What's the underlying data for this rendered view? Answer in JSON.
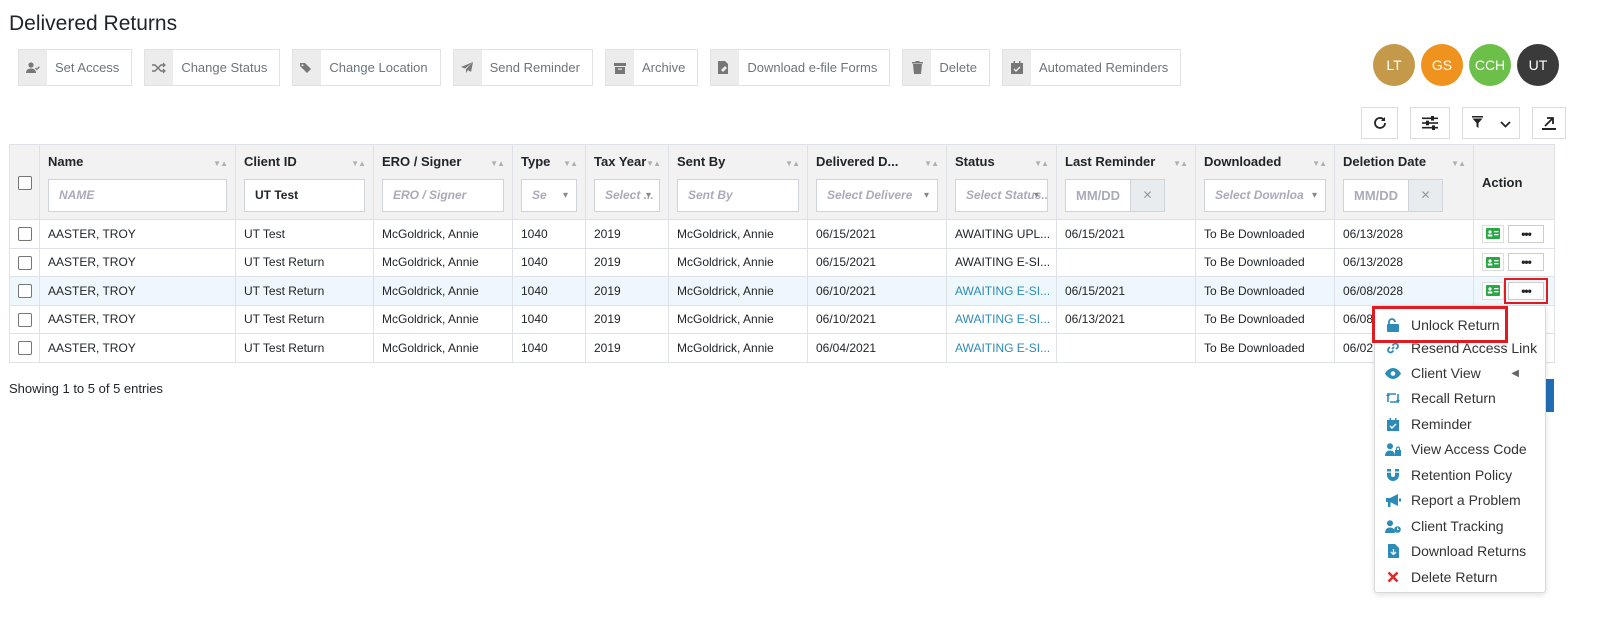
{
  "page": {
    "title": "Delivered Returns"
  },
  "toolbar": [
    {
      "label": "Set Access",
      "icon": "user-check-icon"
    },
    {
      "label": "Change Status",
      "icon": "shuffle-icon"
    },
    {
      "label": "Change Location",
      "icon": "tags-icon"
    },
    {
      "label": "Send Reminder",
      "icon": "paper-plane-icon"
    },
    {
      "label": "Archive",
      "icon": "archive-box-icon"
    },
    {
      "label": "Download e-file Forms",
      "icon": "file-signature-icon"
    },
    {
      "label": "Delete",
      "icon": "trash-icon"
    },
    {
      "label": "Automated Reminders",
      "icon": "calendar-check-icon"
    }
  ],
  "avatars": [
    {
      "initials": "LT",
      "color": "#c49a4a"
    },
    {
      "initials": "GS",
      "color": "#f0921e"
    },
    {
      "initials": "CCH",
      "color": "#6cc04a"
    },
    {
      "initials": "UT",
      "color": "#3a3a3a"
    }
  ],
  "columns": [
    {
      "label": "Name",
      "filter_placeholder": "NAME",
      "filter_type": "text"
    },
    {
      "label": "Client ID",
      "filter_value": "UT Test",
      "filter_type": "text"
    },
    {
      "label": "ERO / Signer",
      "filter_placeholder": "ERO / Signer",
      "filter_type": "text"
    },
    {
      "label": "Type",
      "filter_placeholder": "Se",
      "filter_type": "select"
    },
    {
      "label": "Tax Year",
      "filter_placeholder": "Select ...",
      "filter_type": "select"
    },
    {
      "label": "Sent By",
      "filter_placeholder": "Sent By",
      "filter_type": "text"
    },
    {
      "label": "Delivered D...",
      "filter_placeholder": "Select Delivere",
      "filter_type": "select"
    },
    {
      "label": "Status",
      "filter_placeholder": "Select Status...",
      "filter_type": "select"
    },
    {
      "label": "Last Reminder",
      "filter_placeholder": "MM/DD",
      "filter_type": "date"
    },
    {
      "label": "Downloaded",
      "filter_placeholder": "Select Downloa",
      "filter_type": "select"
    },
    {
      "label": "Deletion Date",
      "filter_placeholder": "MM/DD",
      "filter_type": "date"
    },
    {
      "label": "Action"
    }
  ],
  "rows": [
    {
      "name": "AASTER, TROY",
      "client_id": "UT Test",
      "ero": "McGoldrick, Annie",
      "type": "1040",
      "tax_year": "2019",
      "sent_by": "McGoldrick, Annie",
      "delivered": "06/15/2021",
      "status": "AWAITING UPL...",
      "last_reminder": "06/15/2021",
      "downloaded": "To Be Downloaded",
      "deletion": "06/13/2028"
    },
    {
      "name": "AASTER, TROY",
      "client_id": "UT Test Return",
      "ero": "McGoldrick, Annie",
      "type": "1040",
      "tax_year": "2019",
      "sent_by": "McGoldrick, Annie",
      "delivered": "06/15/2021",
      "status": "AWAITING E-SI...",
      "last_reminder": "",
      "downloaded": "To Be Downloaded",
      "deletion": "06/13/2028"
    },
    {
      "name": "AASTER, TROY",
      "client_id": "UT Test Return",
      "ero": "McGoldrick, Annie",
      "type": "1040",
      "tax_year": "2019",
      "sent_by": "McGoldrick, Annie",
      "delivered": "06/10/2021",
      "status": "AWAITING E-SI...",
      "last_reminder": "06/15/2021",
      "downloaded": "To Be Downloaded",
      "deletion": "06/08/2028"
    },
    {
      "name": "AASTER, TROY",
      "client_id": "UT Test Return",
      "ero": "McGoldrick, Annie",
      "type": "1040",
      "tax_year": "2019",
      "sent_by": "McGoldrick, Annie",
      "delivered": "06/10/2021",
      "status": "AWAITING E-SI...",
      "last_reminder": "06/13/2021",
      "downloaded": "To Be Downloaded",
      "deletion": "06/08"
    },
    {
      "name": "AASTER, TROY",
      "client_id": "UT Test Return",
      "ero": "McGoldrick, Annie",
      "type": "1040",
      "tax_year": "2019",
      "sent_by": "McGoldrick, Annie",
      "delivered": "06/04/2021",
      "status": "AWAITING E-SI...",
      "last_reminder": "",
      "downloaded": "To Be Downloaded",
      "deletion": "06/02"
    }
  ],
  "footer": {
    "showing": "Showing 1 to 5 of 5 entries"
  },
  "context_menu": {
    "items": [
      {
        "label": "Unlock Return",
        "icon": "unlock-icon"
      },
      {
        "label": "Resend Access Link",
        "icon": "link-icon"
      },
      {
        "label": "Client View",
        "icon": "eye-icon"
      },
      {
        "label": "Recall Return",
        "icon": "retweet-icon"
      },
      {
        "label": "Reminder",
        "icon": "calendar-check-icon"
      },
      {
        "label": "View Access Code",
        "icon": "user-lock-icon"
      },
      {
        "label": "Retention Policy",
        "icon": "magnet-icon"
      },
      {
        "label": "Report a Problem",
        "icon": "bullhorn-icon"
      },
      {
        "label": "Client Tracking",
        "icon": "user-clock-icon"
      },
      {
        "label": "Download Returns",
        "icon": "file-download-icon"
      },
      {
        "label": "Delete Return",
        "icon": "times-icon"
      }
    ]
  },
  "colors": {
    "accent": "#2d8bb8",
    "highlight": "#e01b22",
    "row_highlight": "#eef7fb",
    "action_green": "#28a745",
    "delete_red": "#e02b2b"
  }
}
